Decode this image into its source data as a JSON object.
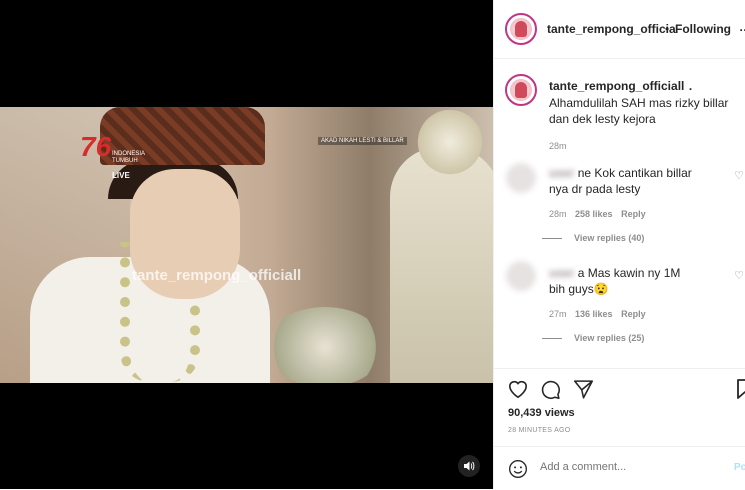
{
  "video": {
    "badge_number": "76",
    "badge_subtext": "INDONESIA TUMBUH",
    "live_label": "LIVE",
    "channel_label": "AKAD NIKAH LESTI & BILLAR",
    "watermark": "tante_rempong_officiall"
  },
  "header": {
    "username": "tante_rempong_officia",
    "separator": "•",
    "follow_status": "Following",
    "more": "…"
  },
  "caption": {
    "username": "tante_rempong_officiall",
    "suffix": ".",
    "text": "Alhamdulilah SAH mas rizky billar dan dek lesty kejora",
    "time": "28m"
  },
  "comments": [
    {
      "username_blurred": "user",
      "text_visible": "ne Kok cantikan billar",
      "text_line2": "nya dr pada lesty",
      "time": "28m",
      "likes": "258 likes",
      "reply": "Reply",
      "view_replies": "View replies (40)"
    },
    {
      "username_blurred": "user",
      "text_visible": "a Mas kawin ny 1M",
      "text_line2": "bih guys😧",
      "time": "27m",
      "likes": "136 likes",
      "reply": "Reply",
      "view_replies": "View replies (25)"
    }
  ],
  "actions": {
    "views": "90,439 views",
    "posted": "28 MINUTES AGO"
  },
  "add_comment": {
    "placeholder": "Add a comment...",
    "post_label": "Po"
  },
  "icons": [
    "heart-icon",
    "comment-icon",
    "share-icon",
    "bookmark-icon",
    "emoji-icon",
    "speaker-icon",
    "more-icon"
  ]
}
